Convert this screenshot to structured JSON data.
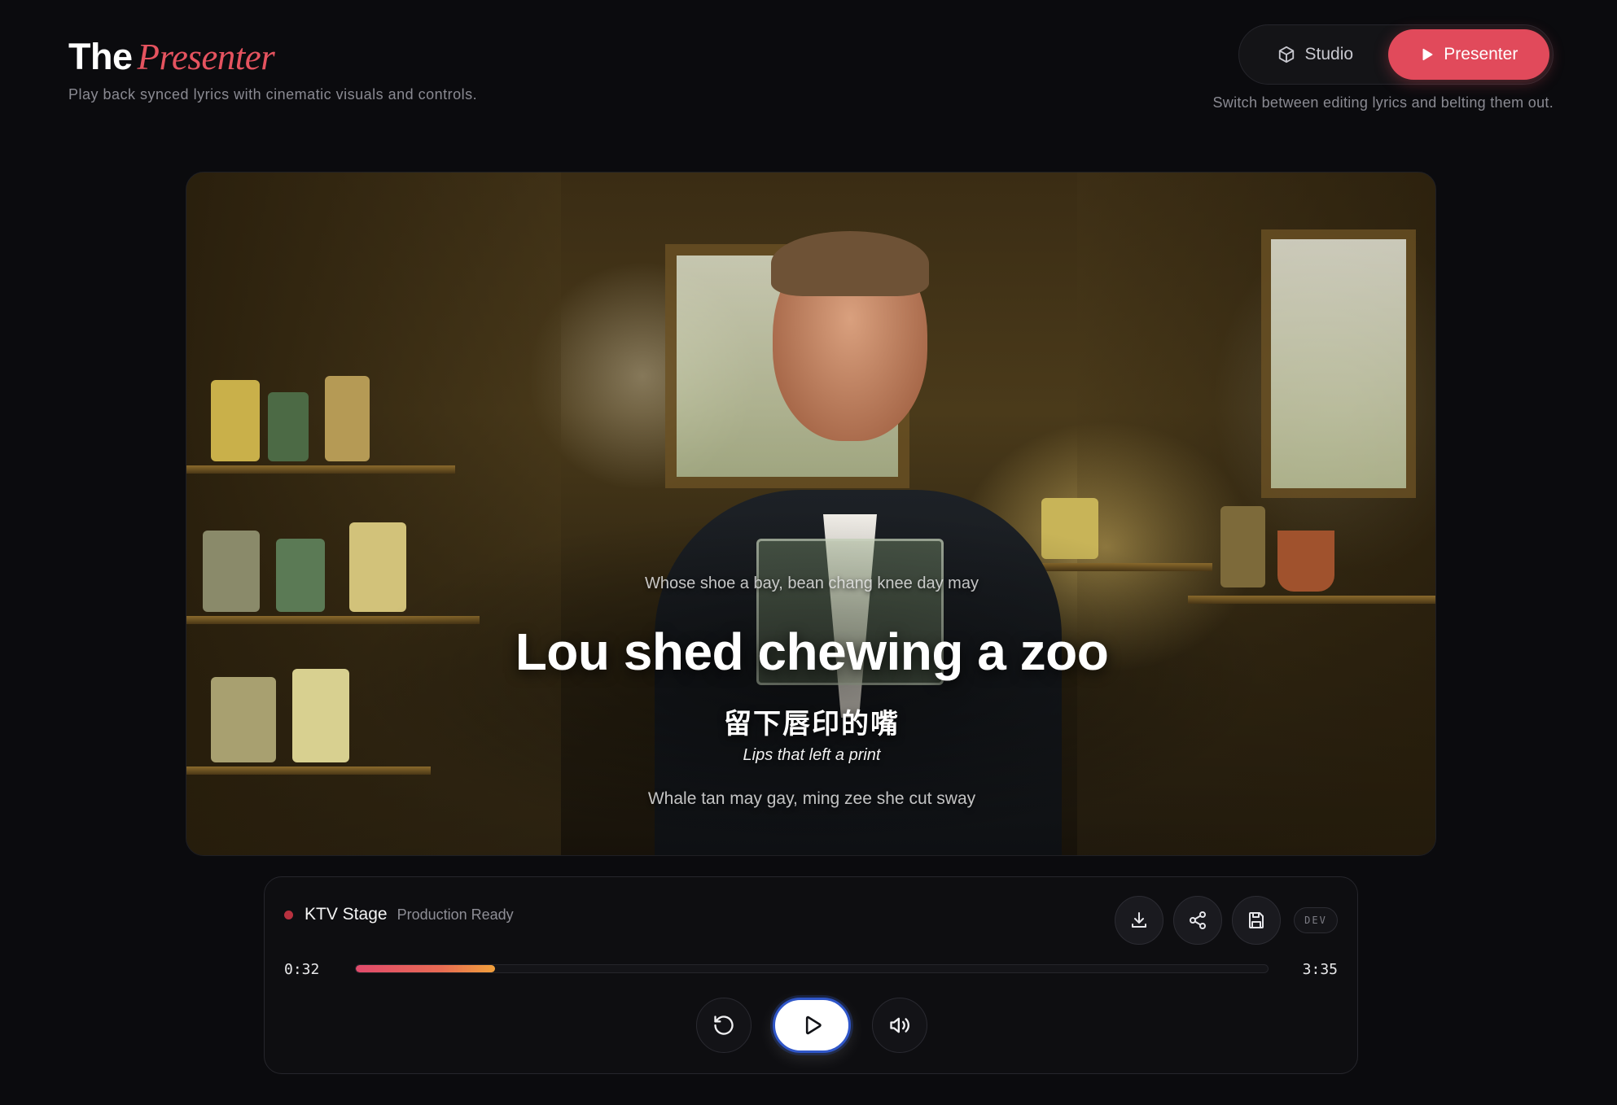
{
  "header": {
    "title_the": "The",
    "title_presenter": "Presenter",
    "subtitle": "Play back synced lyrics with cinematic visuals and controls."
  },
  "mode_switch": {
    "studio_label": "Studio",
    "presenter_label": "Presenter",
    "active": "Presenter",
    "caption": "Switch between editing lyrics and belting them out."
  },
  "stage": {
    "image_description_icon": "man-in-tuxedo-eating-toy-tiger-in-workshop",
    "lyrics": {
      "previous": "Whose shoe a bay, bean chang knee day may",
      "current": "Lou shed chewing a zoo",
      "current_hanzi": "留下唇印的嘴",
      "current_translation": "Lips that left a print",
      "next": "Whale tan may gay, ming zee she cut sway"
    }
  },
  "panel": {
    "stage_name": "KTV Stage",
    "status": "Production Ready",
    "status_dot_color": "#b8313f",
    "tools": [
      "download-icon",
      "share-icon",
      "save-icon"
    ],
    "dev_label": "DEV",
    "current_time": "0:32",
    "total_time": "3:35",
    "progress_fraction": 0.153,
    "transport": [
      "restart-icon",
      "play-icon",
      "volume-icon"
    ]
  },
  "colors": {
    "accent": "#e14a5b",
    "background": "#0b0b0e",
    "focus_ring": "#2f56c9"
  }
}
